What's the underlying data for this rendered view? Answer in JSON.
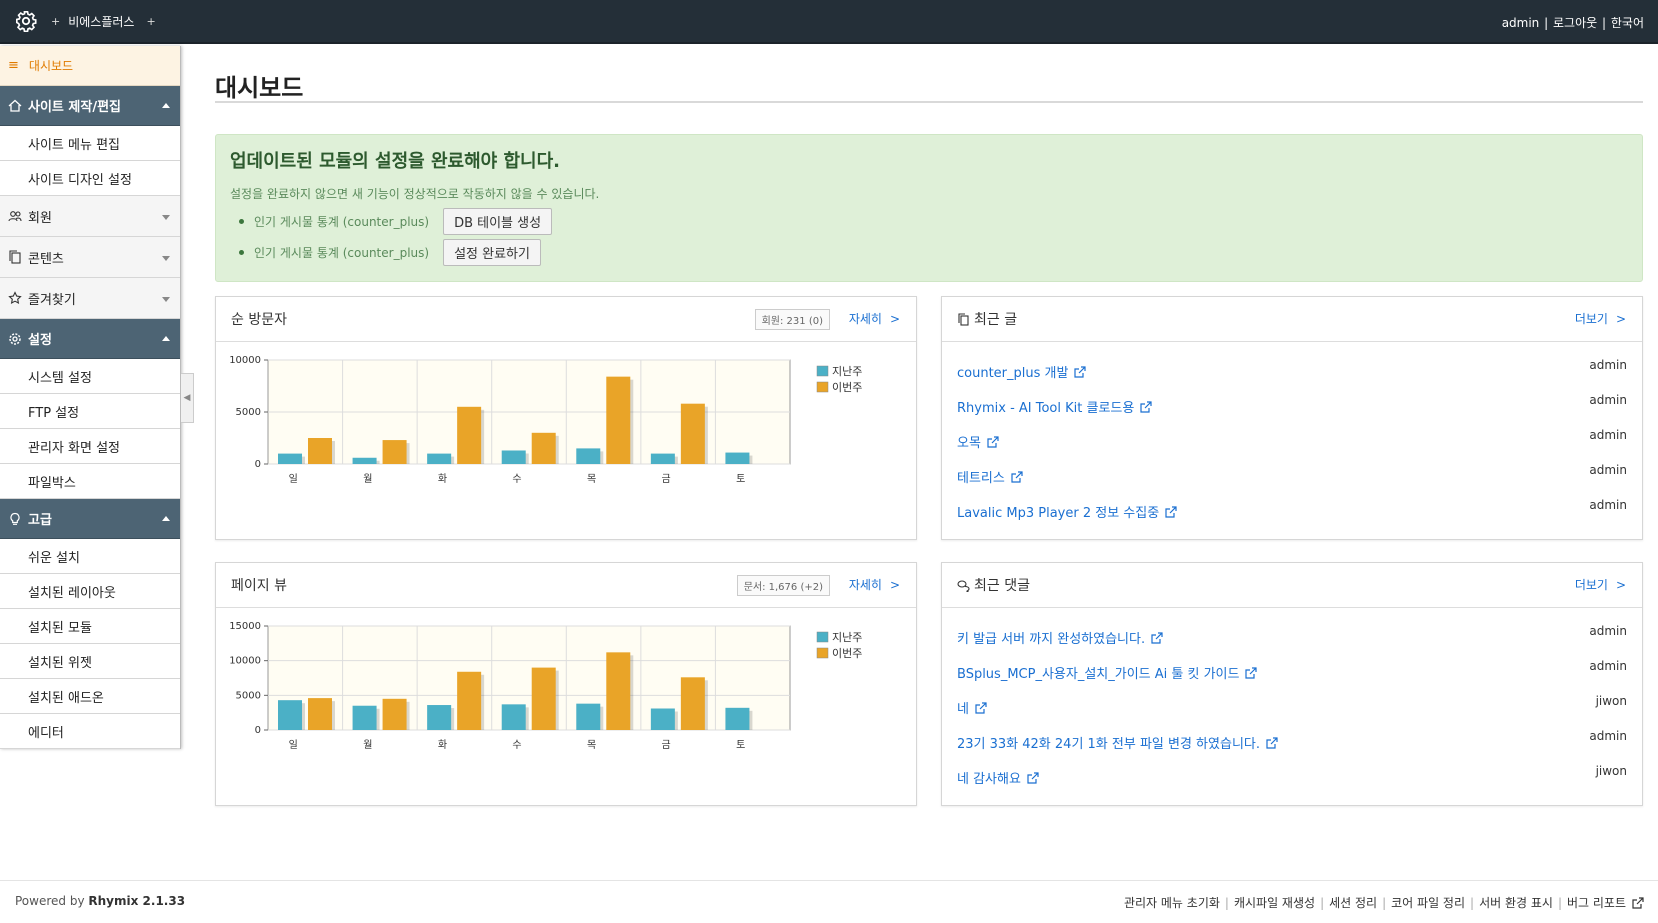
{
  "topbar": {
    "plus": "+",
    "brand": "비에스플러스",
    "plus2": "+",
    "user": "admin",
    "sep": "|",
    "logout": "로그아웃",
    "lang": "한국어"
  },
  "sidebar": {
    "dashboard": "대시보드",
    "site_group": "사이트 제작/편집",
    "site_items": [
      "사이트 메뉴 편집",
      "사이트 디자인 설정"
    ],
    "member": "회원",
    "contents": "콘텐츠",
    "favorites": "즐겨찾기",
    "settings_group": "설정",
    "settings_items": [
      "시스템 설정",
      "FTP 설정",
      "관리자 화면 설정",
      "파일박스"
    ],
    "advanced_group": "고급",
    "advanced_items": [
      "쉬운 설치",
      "설치된 레이아웃",
      "설치된 모듈",
      "설치된 위젯",
      "설치된 애드온",
      "에디터"
    ]
  },
  "main": {
    "title": "대시보드",
    "alert": {
      "title": "업데이트된 모듈의 설정을 완료해야 합니다.",
      "desc": "설정을 완료하지 않으면 새 기능이 정상적으로 작동하지 않을 수 있습니다.",
      "items": [
        {
          "label": "인기 게시물 통계 (counter_plus)",
          "button": "DB 테이블 생성"
        },
        {
          "label": "인기 게시물 통계 (counter_plus)",
          "button": "설정 완료하기"
        }
      ]
    },
    "visitors": {
      "title": "순 방문자",
      "badge": "회원: 231 (0)",
      "more": "자세히",
      "chev": ">"
    },
    "pageviews": {
      "title": "페이지 뷰",
      "badge": "문서: 1,676 (+2)",
      "more": "자세히",
      "chev": ">"
    },
    "recent_posts": {
      "title": "최근 글",
      "more": "더보기",
      "chev": ">",
      "rows": [
        {
          "title": "counter_plus 개발",
          "author": "admin"
        },
        {
          "title": "Rhymix - AI Tool Kit 클로드용",
          "author": "admin"
        },
        {
          "title": "오목",
          "author": "admin"
        },
        {
          "title": "테트리스",
          "author": "admin"
        },
        {
          "title": "Lavalic Mp3 Player 2 정보 수집중",
          "author": "admin"
        }
      ]
    },
    "recent_comments": {
      "title": "최근 댓글",
      "more": "더보기",
      "chev": ">",
      "rows": [
        {
          "title": "키 발급 서버 까지 완성하였습니다.",
          "author": "admin"
        },
        {
          "title": "BSplus_MCP_사용자_설치_가이드 Ai 툴 킷 가이드",
          "author": "admin"
        },
        {
          "title": "네",
          "author": "jiwon"
        },
        {
          "title": "23기 33화 42화 24기 1화 전부 파일 변경 하였습니다.",
          "author": "admin"
        },
        {
          "title": "네 감사해요",
          "author": "jiwon"
        }
      ]
    }
  },
  "colors": {
    "last_week": "#4bb0c6",
    "this_week": "#e9a428"
  },
  "chart_data": [
    {
      "type": "bar",
      "categories": [
        "일",
        "월",
        "화",
        "수",
        "목",
        "금",
        "토"
      ],
      "series": [
        {
          "name": "지난주",
          "values": [
            1000,
            600,
            1000,
            1300,
            1500,
            1000,
            1100
          ]
        },
        {
          "name": "이번주",
          "values": [
            2500,
            2300,
            5500,
            3000,
            8400,
            5800,
            0
          ]
        }
      ],
      "yticks": [
        0,
        5000,
        10000
      ],
      "ylim": [
        0,
        10000
      ],
      "legend": "right"
    },
    {
      "type": "bar",
      "categories": [
        "일",
        "월",
        "화",
        "수",
        "목",
        "금",
        "토"
      ],
      "series": [
        {
          "name": "지난주",
          "values": [
            4300,
            3500,
            3600,
            3700,
            3800,
            3100,
            3200
          ]
        },
        {
          "name": "이번주",
          "values": [
            4600,
            4500,
            8400,
            9000,
            11200,
            7600,
            0
          ]
        }
      ],
      "yticks": [
        0,
        5000,
        10000,
        15000
      ],
      "ylim": [
        0,
        15000
      ],
      "legend": "right"
    }
  ],
  "footer": {
    "powered": "Powered by",
    "product": "Rhymix 2.1.33",
    "links": [
      "관리자 메뉴 초기화",
      "캐시파일 재생성",
      "세션 정리",
      "코어 파일 정리",
      "서버 환경 표시",
      "버그 리포트"
    ],
    "sep": "|"
  }
}
